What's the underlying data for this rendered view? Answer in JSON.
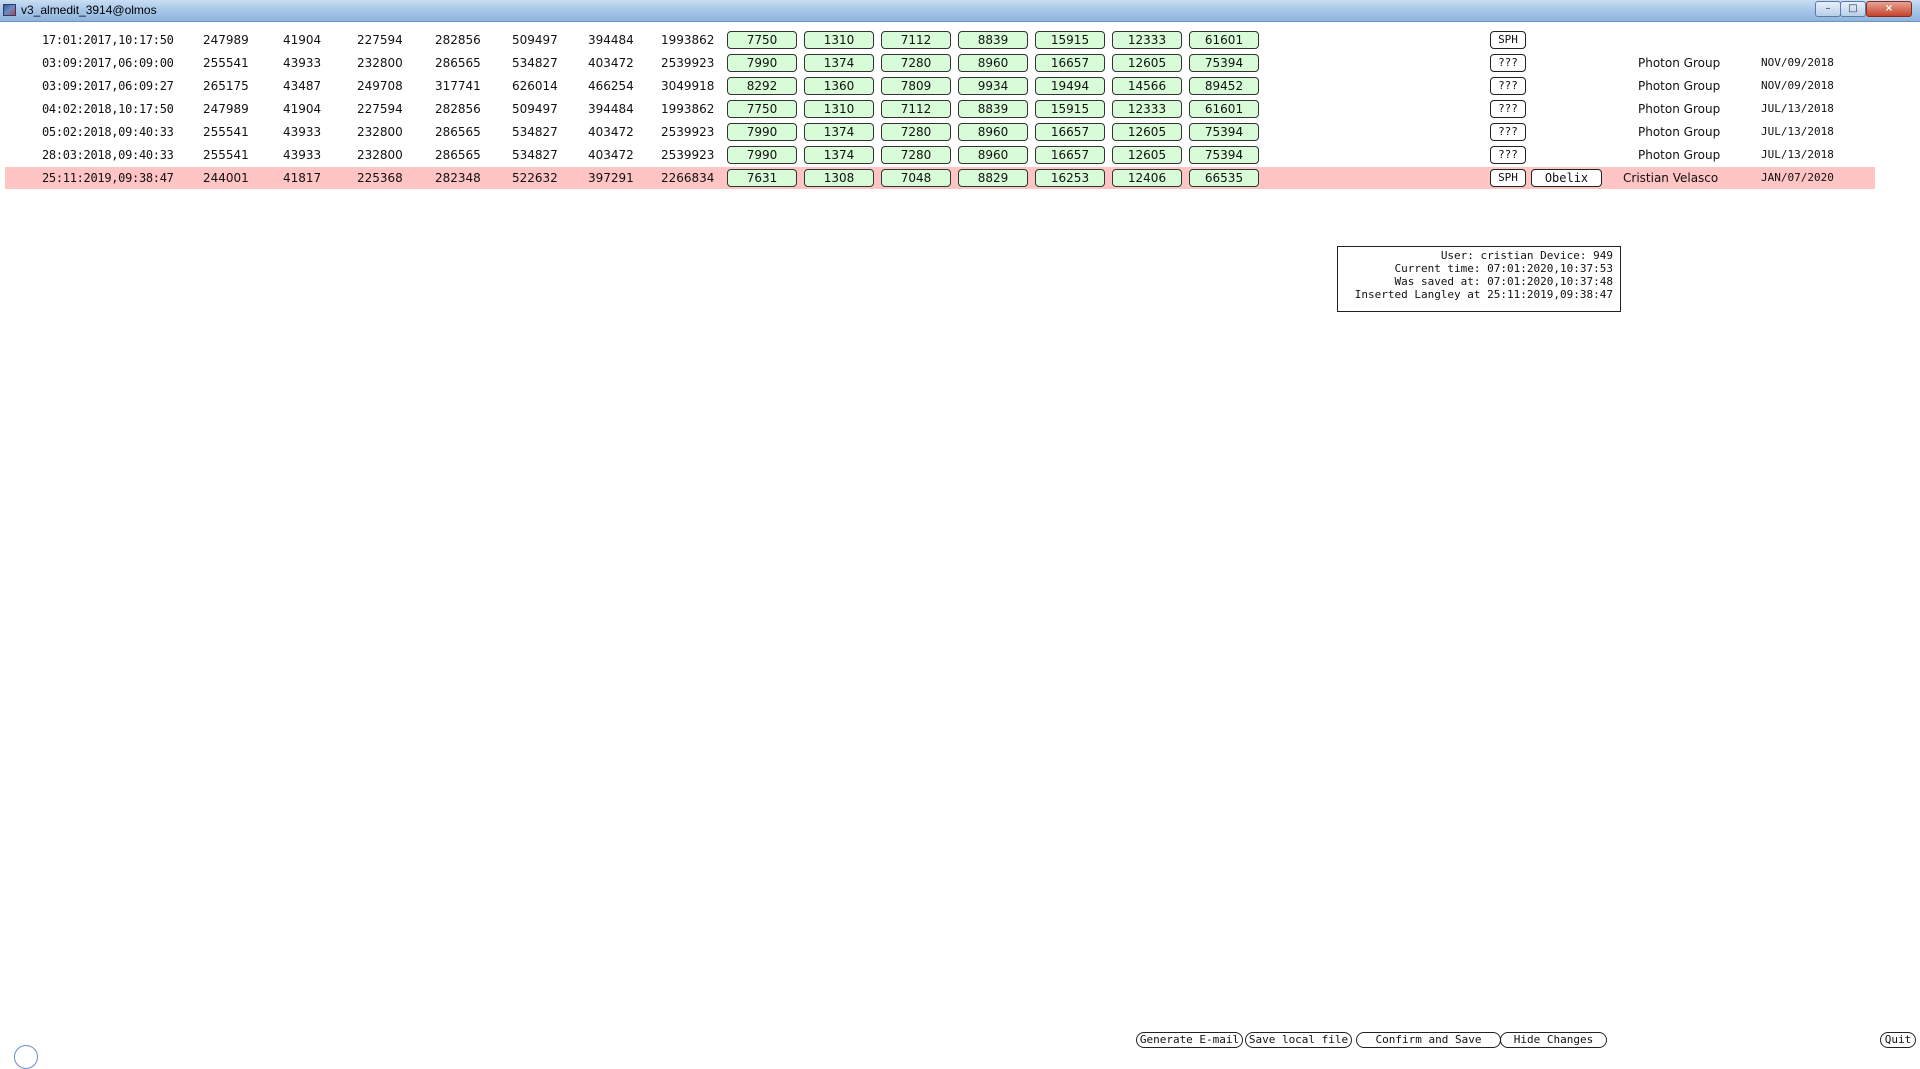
{
  "window": {
    "title": "v3_almedit_3914@olmos",
    "min_label": "–",
    "max_label": "□",
    "close_label": "×"
  },
  "rows": [
    {
      "date": "17:01:2017,10:17:50",
      "n": [
        "247989",
        "41904",
        "227594",
        "282856",
        "509497",
        "394484",
        "1993862"
      ],
      "g": [
        "7750",
        "1310",
        "7112",
        "8839",
        "15915",
        "12333",
        "61601"
      ],
      "status": "SPH",
      "operator": "",
      "group": "",
      "group_date": "",
      "highlight": false
    },
    {
      "date": "03:09:2017,06:09:00",
      "n": [
        "255541",
        "43933",
        "232800",
        "286565",
        "534827",
        "403472",
        "2539923"
      ],
      "g": [
        "7990",
        "1374",
        "7280",
        "8960",
        "16657",
        "12605",
        "75394"
      ],
      "status": "???",
      "operator": "",
      "group": "Photon Group",
      "group_date": "NOV/09/2018",
      "highlight": false
    },
    {
      "date": "03:09:2017,06:09:27",
      "n": [
        "265175",
        "43487",
        "249708",
        "317741",
        "626014",
        "466254",
        "3049918"
      ],
      "g": [
        "8292",
        "1360",
        "7809",
        "9934",
        "19494",
        "14566",
        "89452"
      ],
      "status": "???",
      "operator": "",
      "group": "Photon Group",
      "group_date": "NOV/09/2018",
      "highlight": false
    },
    {
      "date": "04:02:2018,10:17:50",
      "n": [
        "247989",
        "41904",
        "227594",
        "282856",
        "509497",
        "394484",
        "1993862"
      ],
      "g": [
        "7750",
        "1310",
        "7112",
        "8839",
        "15915",
        "12333",
        "61601"
      ],
      "status": "???",
      "operator": "",
      "group": "Photon Group",
      "group_date": "JUL/13/2018",
      "highlight": false
    },
    {
      "date": "05:02:2018,09:40:33",
      "n": [
        "255541",
        "43933",
        "232800",
        "286565",
        "534827",
        "403472",
        "2539923"
      ],
      "g": [
        "7990",
        "1374",
        "7280",
        "8960",
        "16657",
        "12605",
        "75394"
      ],
      "status": "???",
      "operator": "",
      "group": "Photon Group",
      "group_date": "JUL/13/2018",
      "highlight": false
    },
    {
      "date": "28:03:2018,09:40:33",
      "n": [
        "255541",
        "43933",
        "232800",
        "286565",
        "534827",
        "403472",
        "2539923"
      ],
      "g": [
        "7990",
        "1374",
        "7280",
        "8960",
        "16657",
        "12605",
        "75394"
      ],
      "status": "???",
      "operator": "",
      "group": "Photon Group",
      "group_date": "JUL/13/2018",
      "highlight": false
    },
    {
      "date": "25:11:2019,09:38:47",
      "n": [
        "244001",
        "41817",
        "225368",
        "282348",
        "522632",
        "397291",
        "2266834"
      ],
      "g": [
        "7631",
        "1308",
        "7048",
        "8829",
        "16253",
        "12406",
        "66535"
      ],
      "status": "SPH",
      "operator": "Obelix",
      "group": "Cristian Velasco",
      "group_date": "JAN/07/2020",
      "highlight": true
    }
  ],
  "info": {
    "line1": "User: cristian Device: 949",
    "line2": "Current time: 07:01:2020,10:37:53",
    "line3": "Was saved at: 07:01:2020,10:37:48",
    "line4": "Inserted Langley at 25:11:2019,09:38:47"
  },
  "buttons": {
    "email": "Generate E-mail",
    "save_local": "Save local file",
    "confirm": "Confirm and Save",
    "hide": "Hide Changes",
    "quit": "Quit"
  },
  "colors": {
    "highlight_row": "#ffc4c4",
    "value_box": "#d8fbd8",
    "titlebar": "#a9c8e9"
  }
}
